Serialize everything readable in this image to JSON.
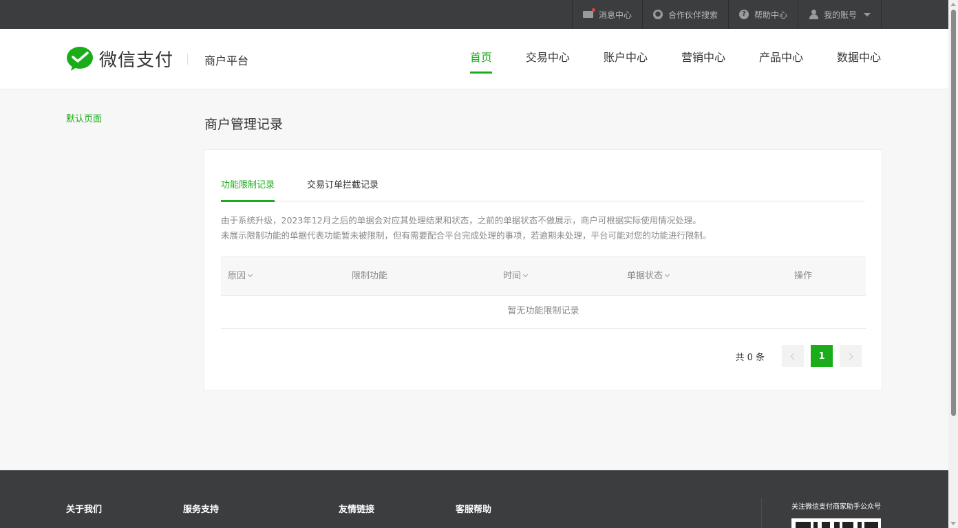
{
  "topbar": {
    "items": [
      {
        "label": "消息中心",
        "icon": "mail-icon"
      },
      {
        "label": "合作伙伴搜索",
        "icon": "search-icon"
      },
      {
        "label": "帮助中心",
        "icon": "help-icon"
      },
      {
        "label": "我的账号",
        "icon": "user-icon"
      }
    ]
  },
  "header": {
    "brand": "微信支付",
    "platform": "商户平台",
    "nav": [
      "首页",
      "交易中心",
      "账户中心",
      "营销中心",
      "产品中心",
      "数据中心"
    ],
    "active_nav": "首页"
  },
  "sidebar": {
    "items": [
      "默认页面"
    ]
  },
  "main": {
    "title": "商户管理记录",
    "tabs": [
      "功能限制记录",
      "交易订单拦截记录"
    ],
    "active_tab": "功能限制记录",
    "notice_lines": [
      "由于系统升级，2023年12月之后的单据会对应其处理结果和状态，之前的单据状态不做展示，商户可根据实际使用情况处理。",
      "未展示限制功能的单据代表功能暂未被限制，但有需要配合平台完成处理的事项，若逾期未处理，平台可能对您的功能进行限制。"
    ],
    "table": {
      "columns": [
        "原因",
        "限制功能",
        "时间",
        "单据状态",
        "操作"
      ],
      "empty_text": "暂无功能限制记录"
    },
    "pager": {
      "total_text": "共 0 条",
      "current_page": "1"
    }
  },
  "footer": {
    "columns": [
      "关于我们",
      "服务支持",
      "友情链接",
      "客服帮助"
    ],
    "qr_title": "关注微信支付商家助手公众号"
  },
  "colors": {
    "accent": "#1aad19",
    "topbar": "#3c3d3f",
    "footer": "#3c3d3f"
  }
}
